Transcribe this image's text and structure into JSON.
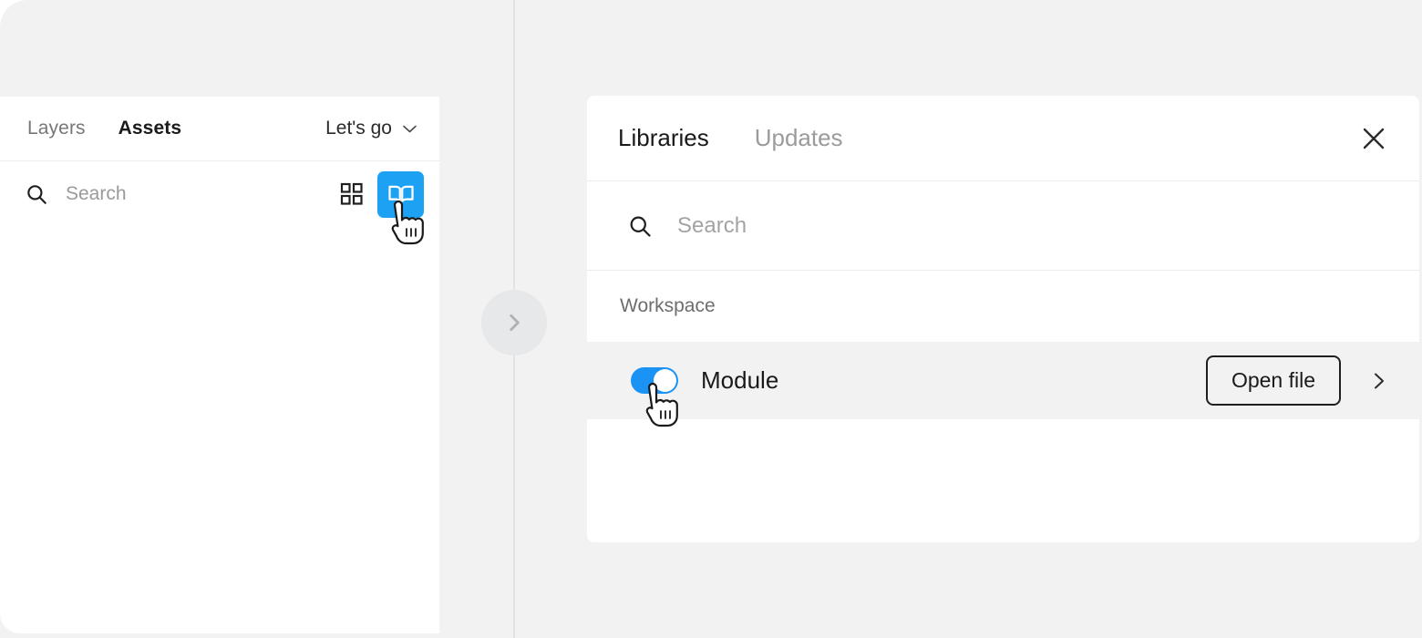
{
  "left_panel": {
    "tabs": [
      {
        "label": "Layers",
        "active": false
      },
      {
        "label": "Assets",
        "active": true
      }
    ],
    "dropdown": {
      "label": "Let's go",
      "icon": "chevron-down-icon"
    },
    "search": {
      "placeholder": "Search",
      "value": "",
      "icon": "search-icon"
    },
    "view_toggles": [
      {
        "name": "grid-view-icon",
        "active": false
      },
      {
        "name": "library-book-icon",
        "active": true,
        "color": "#1da1f2"
      }
    ]
  },
  "divider": {
    "collapse_button": {
      "icon": "chevron-right-icon",
      "color": "#e7e8ea"
    }
  },
  "right_panel": {
    "tabs": [
      {
        "label": "Libraries",
        "active": true
      },
      {
        "label": "Updates",
        "active": false
      }
    ],
    "close_label": "close-icon",
    "search": {
      "placeholder": "Search",
      "value": "",
      "icon": "search-icon"
    },
    "sections": [
      {
        "label": "Workspace",
        "rows": [
          {
            "name": "Module",
            "toggle_on": true,
            "action_label": "Open file",
            "chevron": "chevron-right-icon"
          }
        ]
      }
    ]
  },
  "colors": {
    "accent": "#1da1f2",
    "toggle_on": "#1a93f5",
    "page_bg": "#f2f2f2",
    "panel_bg": "#ffffff",
    "row_bg": "#f2f2f2"
  }
}
